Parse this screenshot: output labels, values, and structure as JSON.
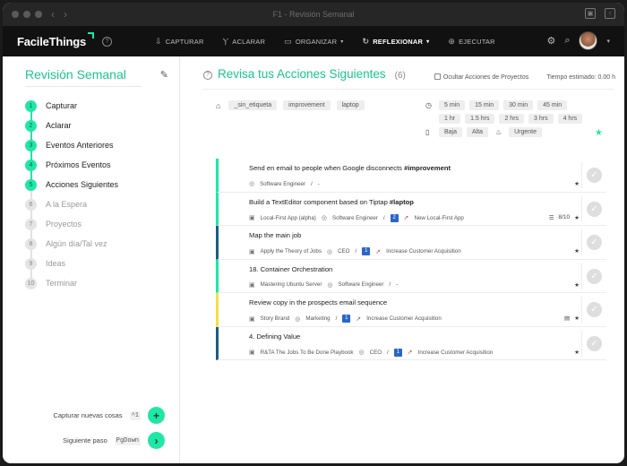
{
  "window": {
    "title": "F1 - Revisión Semanal"
  },
  "nav": {
    "logo": "FacileThings",
    "items": [
      {
        "label": "CAPTURAR",
        "icon": "inbox-tray-icon",
        "glyph": "⇩"
      },
      {
        "label": "ACLARAR",
        "icon": "fork-icon",
        "glyph": "Ⲩ"
      },
      {
        "label": "ORGANIZAR",
        "icon": "folder-icon",
        "glyph": "▭",
        "dropdown": true
      },
      {
        "label": "REFLEXIONAR",
        "icon": "refresh-icon",
        "glyph": "↻",
        "dropdown": true,
        "active": true
      },
      {
        "label": "EJECUTAR",
        "icon": "target-icon",
        "glyph": "⊕"
      }
    ]
  },
  "sidebar": {
    "title": "Revisión Semanal",
    "steps": [
      {
        "n": "1",
        "label": "Capturar",
        "done": true
      },
      {
        "n": "2",
        "label": "Aclarar",
        "done": true
      },
      {
        "n": "3",
        "label": "Eventos Anteriores",
        "done": true
      },
      {
        "n": "4",
        "label": "Próximos Eventos",
        "done": true
      },
      {
        "n": "5",
        "label": "Acciones Siguientes",
        "done": true
      },
      {
        "n": "6",
        "label": "A la Espera",
        "done": false
      },
      {
        "n": "7",
        "label": "Proyectos",
        "done": false
      },
      {
        "n": "8",
        "label": "Algún día/Tal vez",
        "done": false
      },
      {
        "n": "9",
        "label": "Ideas",
        "done": false
      },
      {
        "n": "10",
        "label": "Terminar",
        "done": false
      }
    ],
    "capture_label": "Capturar nuevas cosas",
    "capture_kbd": "^1",
    "next_label": "Siguiente paso",
    "next_kbd": "PgDown"
  },
  "content": {
    "title": "Revisa tus Acciones Siguientes",
    "count": "(6)",
    "hide_projects": "Ocultar Acciones de Proyectos",
    "estimated": "Tiempo estimado: 0.00 h",
    "tags": [
      "_sin_etiqueta",
      "improvement",
      "laptop"
    ],
    "times_row1": [
      "5 min",
      "15 min",
      "30 min",
      "45 min"
    ],
    "times_row2": [
      "1 hr",
      "1.5 hrs",
      "2 hrs",
      "3 hrs",
      "4 hrs"
    ],
    "energy": [
      "Baja",
      "Alta"
    ],
    "urgency": [
      "Urgente"
    ]
  },
  "tasks": [
    {
      "title": "Send en email to people when Google disconnects ",
      "tag": "#improvement",
      "color": "green",
      "meta": [
        "Software Engineer",
        "/",
        "-"
      ],
      "right": []
    },
    {
      "title": "Build a TextEditor component based on Tiptap ",
      "tag": "#laptop",
      "color": "green",
      "meta": [
        "Local-First App (alpha)",
        "Software Engineer",
        "/",
        "2",
        "New Local-First App"
      ],
      "right": [
        "8/10"
      ]
    },
    {
      "title": "Map the main job",
      "tag": "",
      "color": "blue",
      "meta": [
        "Apply the Theory of Jobs",
        "CEO",
        "/",
        "1",
        "Increase Customer Acquisition"
      ],
      "right": []
    },
    {
      "title": "18. Container Orchestration",
      "tag": "",
      "color": "green",
      "meta": [
        "Mastering Ubuntu Server",
        "Software Engineer",
        "/",
        "-"
      ],
      "right": []
    },
    {
      "title": "Review copy in the prospects email sequence",
      "tag": "",
      "color": "yellow",
      "meta": [
        "Story Brand",
        "Marketing",
        "/",
        "1",
        "Increase Customer Acquisition"
      ],
      "right": []
    },
    {
      "title": "4. Defining Value",
      "tag": "",
      "color": "blue",
      "meta": [
        "R&TA The Jobs To Be Done Playbook",
        "CEO",
        "/",
        "1",
        "Increase Customer Acquisition"
      ],
      "right": []
    }
  ]
}
